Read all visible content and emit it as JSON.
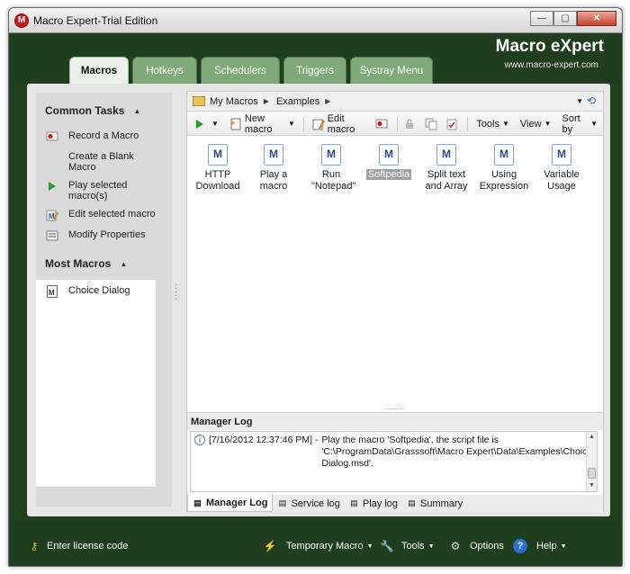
{
  "window": {
    "title": "Macro Expert-Trial Edition",
    "minimize": "—",
    "maximize": "▢",
    "close": "✕"
  },
  "header": {
    "logo": "Macro eXpert",
    "url": "www.macro-expert.com"
  },
  "tabs": [
    {
      "label": "Macros",
      "active": true
    },
    {
      "label": "Hotkeys"
    },
    {
      "label": "Schedulers"
    },
    {
      "label": "Triggers"
    },
    {
      "label": "Systray Menu"
    }
  ],
  "common_tasks": {
    "title": "Common Tasks",
    "items": [
      {
        "label": "Record a Macro",
        "icon": "record-icon"
      },
      {
        "label": "Create a Blank Macro",
        "icon": ""
      },
      {
        "label": "Play selected macro(s)",
        "icon": "play-icon"
      },
      {
        "label": "Edit selected macro",
        "icon": "edit-icon"
      },
      {
        "label": "Modify Properties",
        "icon": "properties-icon"
      }
    ]
  },
  "most_macros": {
    "title": "Most Macros",
    "items": [
      {
        "label": "Choice Dialog",
        "icon": "macro-file-icon"
      }
    ]
  },
  "address": {
    "crumbs": [
      "My Macros",
      "Examples"
    ]
  },
  "toolbar": {
    "new_macro": "New macro",
    "edit_macro": "Edit macro",
    "tools": "Tools",
    "view": "View",
    "sort_by": "Sort by"
  },
  "macros": [
    {
      "label": "HTTP Download"
    },
    {
      "label": "Play a macro"
    },
    {
      "label": "Run \"Notepad\""
    },
    {
      "label": "Softpedia",
      "selected": true
    },
    {
      "label": "Split text and Array"
    },
    {
      "label": "Using Expression"
    },
    {
      "label": "Variable Usage"
    }
  ],
  "log": {
    "title": "Manager Log",
    "entries": [
      {
        "time": "[7/16/2012 12:37:46 PM] -",
        "text": "Play the macro 'Softpedia', the script file is 'C:\\ProgramData\\Grasssoft\\Macro Expert\\Data\\Examples\\Choice Dialog.msd'."
      }
    ],
    "tabs": [
      {
        "label": "Manager Log",
        "active": true
      },
      {
        "label": "Service log"
      },
      {
        "label": "Play log"
      },
      {
        "label": "Summary"
      }
    ]
  },
  "statusbar": {
    "license": "Enter license code",
    "temporary_macro": "Temporary Macro",
    "tools": "Tools",
    "options": "Options",
    "help": "Help"
  },
  "colors": {
    "frame_green": "#1e3e1e",
    "tab_green": "#7fa97a",
    "panel_gray": "#e5e6e5"
  }
}
